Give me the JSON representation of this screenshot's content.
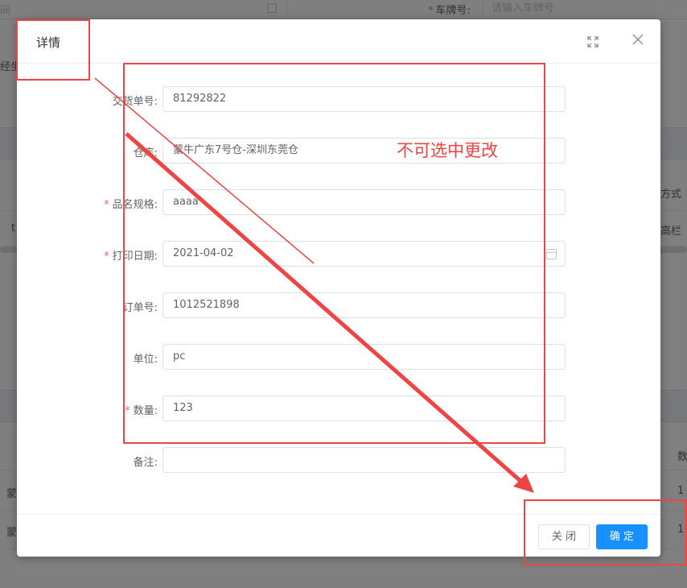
{
  "background": {
    "date_fragment": "间",
    "plate_label": "车牌号:",
    "plate_placeholder": "请输入车牌号",
    "coord_fragment": "经坐",
    "right_col_1": "运方式",
    "right_col_2": "长高栏",
    "row_left_t": "t",
    "row_left_1": "蒙",
    "row_left_2": "蒙",
    "right_col_3": "数",
    "right_col_4": "1",
    "right_col_5": "1"
  },
  "dialog": {
    "title": "详情",
    "fields": [
      {
        "label": "交货单号:",
        "required": false,
        "value": "81292822"
      },
      {
        "label": "仓库:",
        "required": false,
        "value": "蒙牛广东7号仓-深圳东莞仓"
      },
      {
        "label": "品名规格:",
        "required": true,
        "value": "aaaa"
      },
      {
        "label": "打印日期:",
        "required": true,
        "value": "2021-04-02",
        "has_calendar": true
      },
      {
        "label": "订单号:",
        "required": false,
        "value": "1012521898"
      },
      {
        "label": "单位:",
        "required": false,
        "value": "pc"
      },
      {
        "label": "数量:",
        "required": true,
        "value": "123"
      },
      {
        "label": "备注:",
        "required": false,
        "value": ""
      }
    ],
    "close_button": "关 闭",
    "ok_button": "确 定"
  },
  "annotation": {
    "note": "不可选中更改",
    "color": "#ef4444"
  },
  "colors": {
    "primary": "#1890ff",
    "required": "#f56c6c"
  },
  "icons": [
    "fullscreen-icon",
    "close-icon",
    "calendar-icon"
  ]
}
